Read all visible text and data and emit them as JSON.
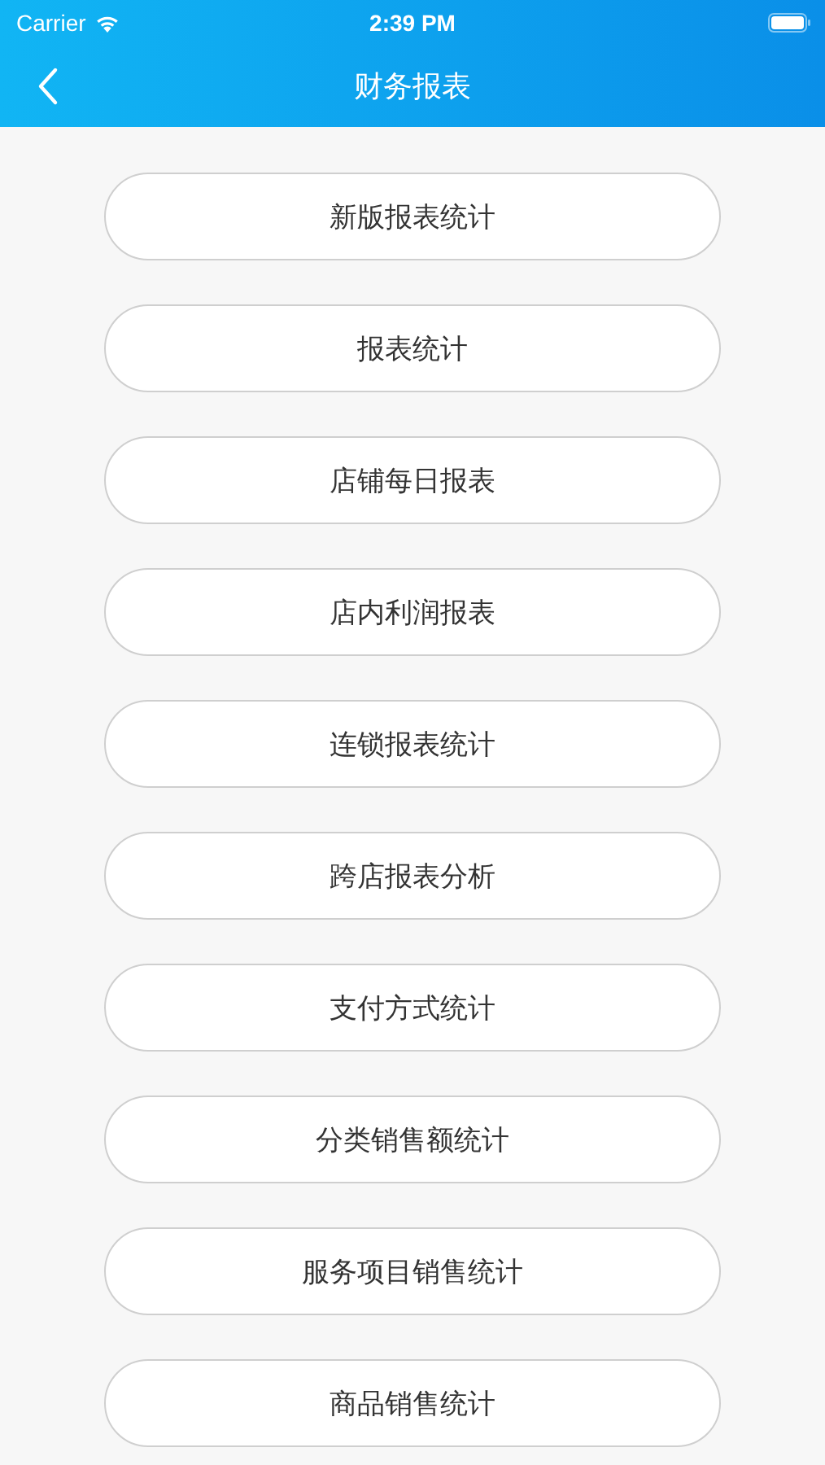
{
  "status_bar": {
    "carrier": "Carrier",
    "time": "2:39 PM"
  },
  "nav": {
    "title": "财务报表"
  },
  "menu": [
    {
      "label": "新版报表统计"
    },
    {
      "label": "报表统计"
    },
    {
      "label": "店铺每日报表"
    },
    {
      "label": "店内利润报表"
    },
    {
      "label": "连锁报表统计"
    },
    {
      "label": "跨店报表分析"
    },
    {
      "label": "支付方式统计"
    },
    {
      "label": "分类销售额统计"
    },
    {
      "label": "服务项目销售统计"
    },
    {
      "label": "商品销售统计"
    }
  ]
}
